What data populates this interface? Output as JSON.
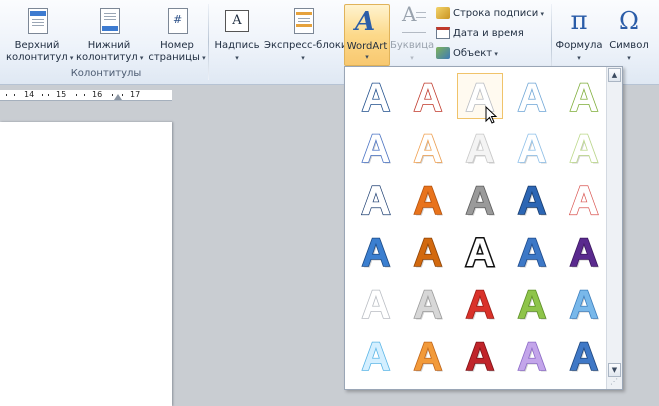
{
  "ribbon": {
    "header_footer_group": {
      "label": "Колонтитулы",
      "buttons": [
        {
          "line1": "Верхний",
          "line2": "колонтитул"
        },
        {
          "line1": "Нижний",
          "line2": "колонтитул"
        },
        {
          "line1": "Номер",
          "line2": "страницы"
        }
      ]
    },
    "text_group": {
      "buttons": [
        {
          "label": "Надпись"
        },
        {
          "label": "Экспресс-блоки"
        },
        {
          "label": "WordArt"
        },
        {
          "label": "Буквица"
        }
      ],
      "small": [
        {
          "label": "Строка подписи"
        },
        {
          "label": "Дата и время"
        },
        {
          "label": "Объект"
        }
      ]
    },
    "symbols_group": {
      "buttons": [
        {
          "label": "Формула",
          "glyph": "π"
        },
        {
          "label": "Символ",
          "glyph": "Ω"
        }
      ]
    }
  },
  "ruler": {
    "numbers": [
      "14",
      "15",
      "16",
      "17"
    ]
  },
  "gallery": {
    "glyph": "A",
    "selected_index": 2,
    "styles": [
      {
        "fill": "#ffffff",
        "stroke": "#1f4e8c",
        "style": "outline"
      },
      {
        "fill": "#ffffff",
        "stroke": "#c0392b",
        "style": "outline"
      },
      {
        "fill": "#ffffff",
        "stroke": "#b8bcc2",
        "style": "outline"
      },
      {
        "fill": "#ffffff",
        "stroke": "#6fa6d6",
        "style": "outline"
      },
      {
        "fill": "#ffffff",
        "stroke": "#7fae3a",
        "style": "outline"
      },
      {
        "fill": "#ffffff",
        "stroke": "#4a73c4",
        "style": "glow"
      },
      {
        "fill": "#ffffff",
        "stroke": "#f0a050",
        "style": "glow"
      },
      {
        "fill": "#f4f4f4",
        "stroke": "#c8c8c8",
        "style": "glow"
      },
      {
        "fill": "#ffffff",
        "stroke": "#8ec0ea",
        "style": "glow"
      },
      {
        "fill": "#ffffff",
        "stroke": "#bcd98a",
        "style": "glow"
      },
      {
        "fill": "#ffffff",
        "stroke": "#17396d",
        "style": "double"
      },
      {
        "fill": "#e8731c",
        "stroke": "#b5520d",
        "style": "solid"
      },
      {
        "fill": "#9a9a9a",
        "stroke": "#5c5c5c",
        "style": "solid"
      },
      {
        "fill": "#2c66b4",
        "stroke": "#163b6e",
        "style": "solid"
      },
      {
        "fill": "#ffffff",
        "stroke": "#d9534f",
        "style": "double"
      },
      {
        "fill": "#3b7fd0",
        "stroke": "#1b4a86",
        "style": "solid"
      },
      {
        "fill": "#d2690e",
        "stroke": "#8f4305",
        "style": "solid"
      },
      {
        "fill": "#ffffff",
        "stroke": "#111111",
        "style": "heavy"
      },
      {
        "fill": "#3d78c6",
        "stroke": "#1c4a8c",
        "style": "solid"
      },
      {
        "fill": "#5a2a8e",
        "stroke": "#3b1660",
        "style": "solid"
      },
      {
        "fill": "#ffffff",
        "stroke": "#b9bdc3",
        "style": "outline"
      },
      {
        "fill": "#d7d7d7",
        "stroke": "#9c9c9c",
        "style": "solid"
      },
      {
        "fill": "#d9322a",
        "stroke": "#9e1a14",
        "style": "solid"
      },
      {
        "fill": "#8ec44a",
        "stroke": "#5c8f25",
        "style": "solid"
      },
      {
        "fill": "#79b8ea",
        "stroke": "#3c7fbf",
        "style": "solid"
      },
      {
        "fill": "#d4efff",
        "stroke": "#59b5e6",
        "style": "outline"
      },
      {
        "fill": "#f29a3a",
        "stroke": "#c1661a",
        "style": "solid"
      },
      {
        "fill": "#c0242a",
        "stroke": "#7e1015",
        "style": "solid"
      },
      {
        "fill": "#c3a5ea",
        "stroke": "#8c6ac7",
        "style": "solid"
      },
      {
        "fill": "#3f78c6",
        "stroke": "#1d467f",
        "style": "solid"
      }
    ]
  }
}
